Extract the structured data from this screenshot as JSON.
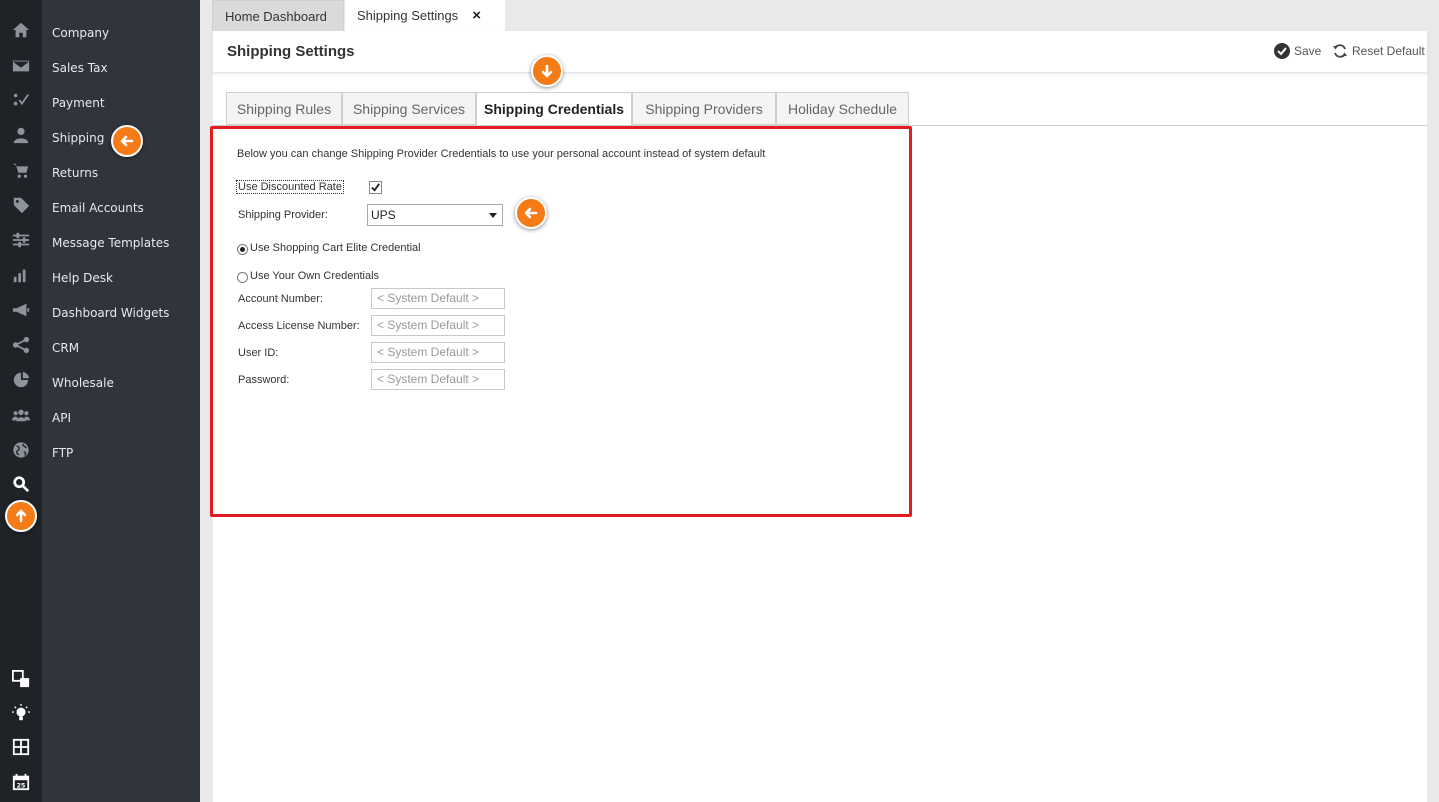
{
  "rail_icons": [
    "home-icon",
    "mail-icon",
    "checklist-icon",
    "user-icon",
    "cart-icon",
    "tag-icon",
    "sliders-icon",
    "bar-chart-icon",
    "megaphone-icon",
    "share-icon",
    "pie-chart-icon",
    "group-icon",
    "globe-icon",
    "settings-gear-icon",
    "window-layout-icon",
    "lightbulb-icon",
    "calculator-icon",
    "calendar-icon"
  ],
  "calendar_day": "25",
  "menu": {
    "items": [
      "Company",
      "Sales Tax",
      "Payment",
      "Shipping",
      "Returns",
      "Email Accounts",
      "Message Templates",
      "Help Desk",
      "Dashboard Widgets",
      "CRM",
      "Wholesale",
      "API",
      "FTP"
    ]
  },
  "window_tabs": {
    "home": "Home Dashboard",
    "active": "Shipping Settings",
    "close": "×"
  },
  "header": {
    "title": "Shipping Settings",
    "save": "Save",
    "reset": "Reset Default"
  },
  "tabs": [
    "Shipping Rules",
    "Shipping Services",
    "Shipping Credentials",
    "Shipping Providers",
    "Holiday Schedule"
  ],
  "active_tab": "Shipping Credentials",
  "form": {
    "intro": "Below you can change Shipping Provider Credentials to use your personal account instead of system default",
    "use_discounted_label": "Use Discounted Rate",
    "use_discounted_checked": true,
    "provider_label": "Shipping Provider:",
    "provider_value": "UPS",
    "radio_elite": "Use Shopping Cart Elite Credential",
    "radio_own": "Use Your Own Credentials",
    "selected_radio": "elite",
    "fields": [
      {
        "label": "Account Number:",
        "placeholder": "< System Default >"
      },
      {
        "label": "Access License Number:",
        "placeholder": "< System Default >"
      },
      {
        "label": "User ID:",
        "placeholder": "< System Default >"
      },
      {
        "label": "Password:",
        "placeholder": "< System Default >"
      }
    ]
  },
  "colors": {
    "rail_bg": "#1f2328",
    "menu_bg": "#30353c",
    "accent_orange": "#f47b16",
    "highlight_red": "#e31b23"
  }
}
